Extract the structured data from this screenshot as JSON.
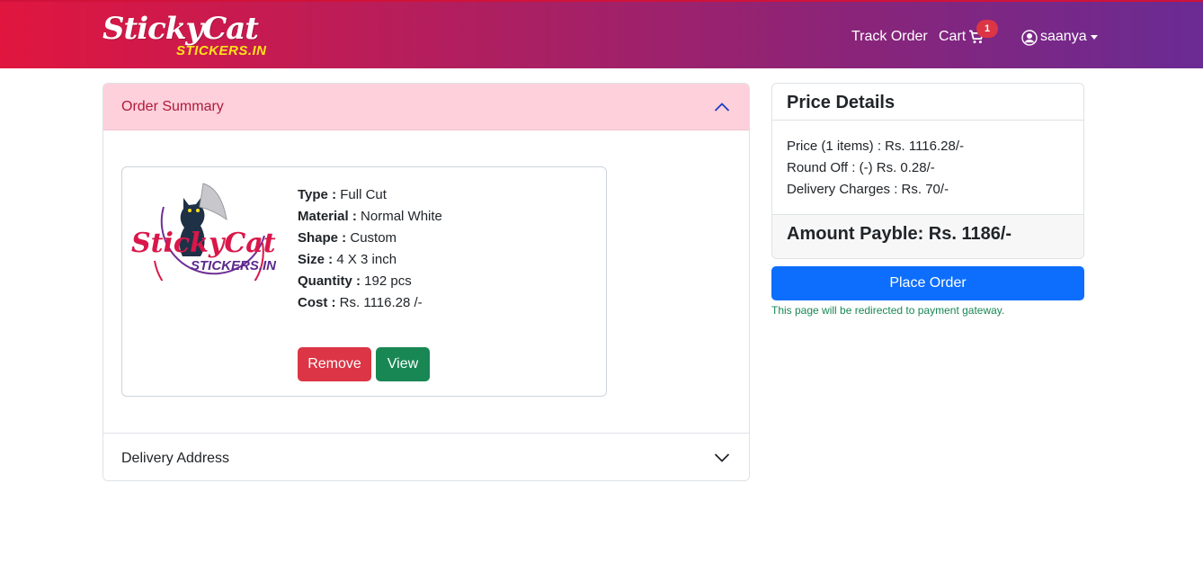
{
  "brand": {
    "script": "StickyCat",
    "sub": "STICKERS.IN",
    "sub_color": "#ffe21a"
  },
  "nav": {
    "track_order": "Track Order",
    "cart": "Cart",
    "cart_count": "1",
    "user": "saanya",
    "cart_icon": "cart-icon",
    "user_icon": "user-circle-icon"
  },
  "order_summary": {
    "title": "Order Summary",
    "item": {
      "logo_text": "StickyCat",
      "logo_sub": "STICKERS.IN",
      "type_label": "Type :",
      "type_value": "Full Cut",
      "material_label": "Material :",
      "material_value": "Normal White",
      "shape_label": "Shape :",
      "shape_value": "Custom",
      "size_label": "Size :",
      "size_value": "4 X 3 inch",
      "quantity_label": "Quantity :",
      "quantity_value": "192 pcs",
      "cost_label": "Cost :",
      "cost_value": "Rs. 1116.28 /-",
      "remove_label": "Remove",
      "view_label": "View"
    }
  },
  "delivery_address": {
    "title": "Delivery Address"
  },
  "price_details": {
    "title": "Price Details",
    "price_line": "Price (1 items) : Rs. 1116.28/-",
    "round_off_line": "Round Off : (-) Rs. 0.28/-",
    "delivery_line": "Delivery Charges : Rs. 70/-",
    "amount_payable": "Amount Payble: Rs. 1186/-"
  },
  "place_order": {
    "label": "Place Order",
    "note": "This page will be redirected to payment gateway."
  },
  "colors": {
    "nav_gradient_start": "#e0163f",
    "nav_gradient_end": "#6a2b93",
    "accordion_active_bg": "#fdd0dc",
    "remove": "#dc3545",
    "view": "#198754",
    "place_order": "#0d6efd"
  }
}
